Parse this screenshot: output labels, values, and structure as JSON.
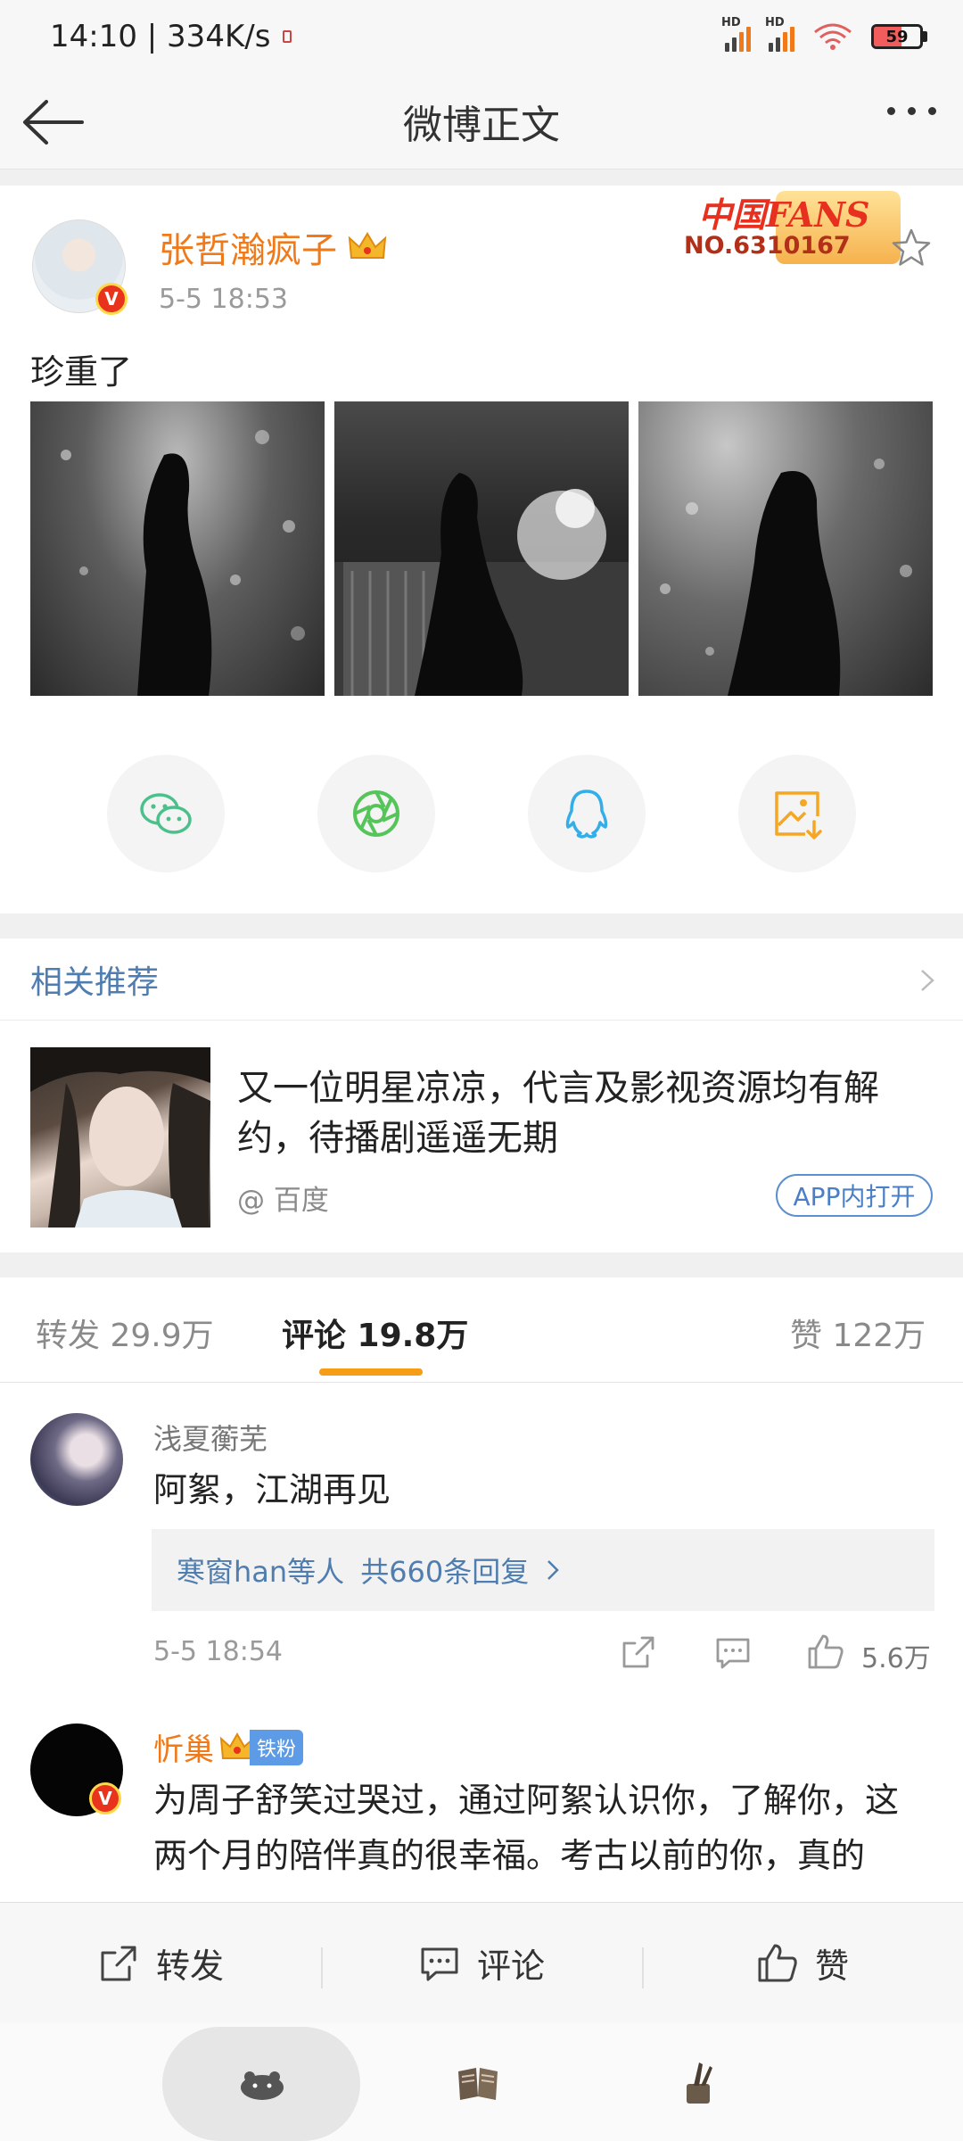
{
  "status_bar": {
    "time_speed": "14:10 | 334K/s",
    "signal1_label": "HD",
    "signal2_label": "HD",
    "battery_level": 59,
    "battery_text": "59",
    "battery_color": "#f15d5d"
  },
  "nav": {
    "title": "微博正文",
    "back_icon": "arrow-left-icon",
    "more_icon": "more-dots-icon"
  },
  "post": {
    "author": "张哲瀚疯子",
    "time": "5-5 18:53",
    "text": "珍重了",
    "fans_badge_title": "中国FANS",
    "fans_badge_no": "NO.6310167",
    "verified_mark": "V"
  },
  "share": {
    "icons": [
      "wechat-icon",
      "moments-icon",
      "qq-icon",
      "save-image-icon"
    ],
    "colors": {
      "wechat": "#4cc08a",
      "moments": "#55c55a",
      "qq": "#33aee8",
      "save": "#f5a623"
    }
  },
  "related": {
    "title": "相关推荐",
    "article_title": "又一位明星凉凉，代言及影视资源均有解约，待播剧遥遥无期",
    "source": "@ 百度",
    "open_button": "APP内打开"
  },
  "tabs": {
    "repost": "转发 29.9万",
    "comment": "评论 19.8万",
    "like": "赞 122万",
    "accent": "#f59d14"
  },
  "comments": [
    {
      "name": "浅夏蘅芜",
      "text": "阿絮，江湖再见",
      "reply_users": "寒窗han等人",
      "reply_count": "共660条回复",
      "time": "5-5 18:54",
      "likes": "5.6万"
    },
    {
      "name": "忻巢",
      "badge": "铁粉",
      "line1": "为周子舒笑过哭过，通过阿絮认识你，了解你，这",
      "line2": "两个月的陪伴真的很幸福。考古以前的你，真的"
    }
  ],
  "actions": {
    "repost": "转发",
    "comment": "评论",
    "like": "赞"
  }
}
